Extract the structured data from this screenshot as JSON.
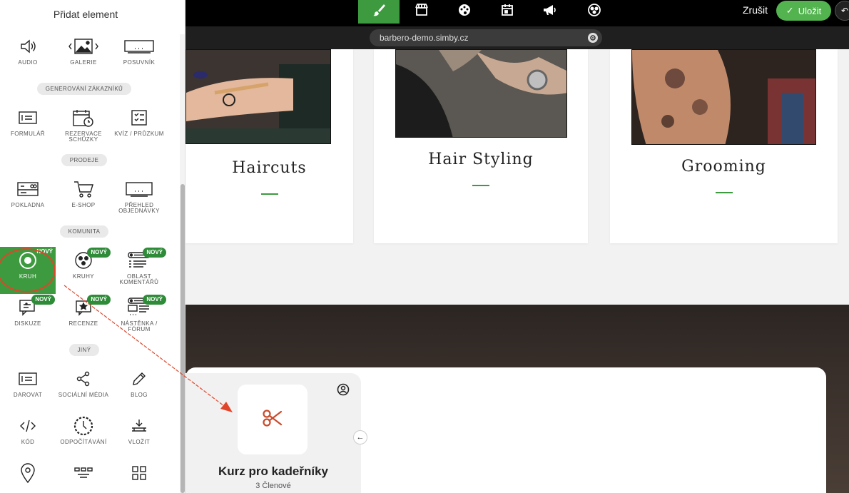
{
  "panel": {
    "title": "Přidat element",
    "new_badge": "NOVÝ",
    "rows": [
      {
        "items": [
          {
            "name": "audio",
            "label": "AUDIO",
            "icon": "speaker-icon"
          },
          {
            "name": "gallery",
            "label": "GALERIE",
            "icon": "gallery-icon"
          },
          {
            "name": "slider",
            "label": "POSUVNÍK",
            "icon": "slider-icon"
          }
        ]
      },
      {
        "section": "GENEROVÁNÍ ZÁKAZNÍKŮ"
      },
      {
        "items": [
          {
            "name": "form",
            "label": "FORMULÁŘ",
            "icon": "form-icon"
          },
          {
            "name": "booking",
            "label": "REZERVACE SCHŮZKY",
            "icon": "calendar-clock-icon"
          },
          {
            "name": "quiz",
            "label": "KVÍZ / PRŮZKUM",
            "icon": "checklist-icon"
          }
        ]
      },
      {
        "section": "PRODEJE"
      },
      {
        "items": [
          {
            "name": "checkout",
            "label": "POKLADNA",
            "icon": "checkout-icon"
          },
          {
            "name": "eshop",
            "label": "E-SHOP",
            "icon": "cart-icon"
          },
          {
            "name": "orders",
            "label": "PŘEHLED OBJEDNÁVKY",
            "icon": "orders-icon"
          }
        ]
      },
      {
        "section": "KOMUNITA"
      },
      {
        "items": [
          {
            "name": "circle",
            "label": "KRUH",
            "icon": "circle-icon",
            "new": true,
            "selected": true
          },
          {
            "name": "circles",
            "label": "KRUHY",
            "icon": "circles-icon",
            "new": true
          },
          {
            "name": "comments",
            "label": "OBLAST KOMENTÁŘŮ",
            "icon": "comments-icon",
            "new": true
          }
        ]
      },
      {
        "items": [
          {
            "name": "discussion",
            "label": "DISKUZE",
            "icon": "discussion-icon",
            "new": true
          },
          {
            "name": "reviews",
            "label": "RECENZE",
            "icon": "review-icon",
            "new": true
          },
          {
            "name": "forum",
            "label": "NÁSTĚNKA / FÓRUM",
            "icon": "forum-icon",
            "new": true
          }
        ]
      },
      {
        "section": "JINÝ"
      },
      {
        "items": [
          {
            "name": "donate",
            "label": "DAROVAT",
            "icon": "donate-icon"
          },
          {
            "name": "social",
            "label": "SOCIÁLNÍ MÉDIA",
            "icon": "share-icon"
          },
          {
            "name": "blog",
            "label": "BLOG",
            "icon": "pencil-icon"
          }
        ]
      },
      {
        "items": [
          {
            "name": "code",
            "label": "KÓD",
            "icon": "code-icon"
          },
          {
            "name": "countdown",
            "label": "ODPOČÍTÁVÁNÍ",
            "icon": "countdown-icon"
          },
          {
            "name": "embed",
            "label": "VLOŽIT",
            "icon": "embed-icon"
          }
        ]
      },
      {
        "items": [
          {
            "name": "map",
            "label": "",
            "icon": "map-pin-icon"
          },
          {
            "name": "menu",
            "label": "",
            "icon": "menu-icon"
          },
          {
            "name": "grid",
            "label": "",
            "icon": "grid-icon"
          }
        ]
      }
    ]
  },
  "topbar": {
    "tools": [
      "brush-icon",
      "store-icon",
      "palette-icon",
      "calendar-icon",
      "megaphone-icon",
      "community-icon"
    ],
    "cancel_label": "Zrušit",
    "save_label": "Uložit"
  },
  "urlbar": {
    "url": "barbero-demo.simby.cz"
  },
  "services": [
    {
      "title": "Haircuts"
    },
    {
      "title": "Hair Styling"
    },
    {
      "title": "Grooming"
    }
  ],
  "group_card": {
    "name": "Kurz pro kadeřníky",
    "members": "3 Členové"
  },
  "colors": {
    "accent": "#3d9a3f",
    "save": "#52b34f",
    "selection_ring": "#e0452a",
    "scissors": "#c94a2b"
  }
}
